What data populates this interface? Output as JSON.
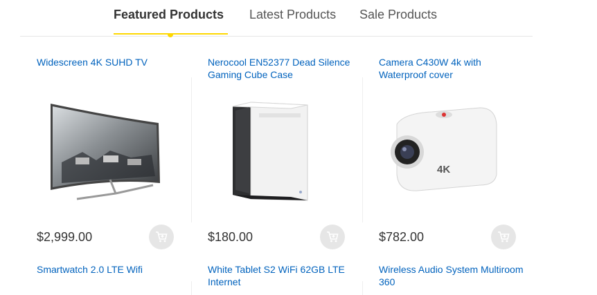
{
  "tabs": [
    {
      "label": "Featured Products",
      "active": true
    },
    {
      "label": "Latest Products",
      "active": false
    },
    {
      "label": "Sale Products",
      "active": false
    }
  ],
  "colors": {
    "accent": "#fed700",
    "link": "#0062bd",
    "cart_bg": "#e6e6e6"
  },
  "products": [
    {
      "title": "Widescreen 4K SUHD TV",
      "price": "$2,999.00",
      "image": "curved-tv-image"
    },
    {
      "title": "Nerocool EN52377 Dead Silence Gaming Cube Case",
      "price": "$180.00",
      "image": "pc-case-image"
    },
    {
      "title": "Camera C430W 4k with Waterproof cover",
      "price": "$782.00",
      "image": "action-camera-image"
    }
  ],
  "products_row2": [
    {
      "title": "Smartwatch 2.0 LTE Wifi"
    },
    {
      "title": "White Tablet S2 WiFi 62GB LTE Internet"
    },
    {
      "title": "Wireless Audio System Multiroom 360"
    }
  ],
  "icons": {
    "cart": "add-to-cart-icon"
  },
  "camera_badge": "4K"
}
